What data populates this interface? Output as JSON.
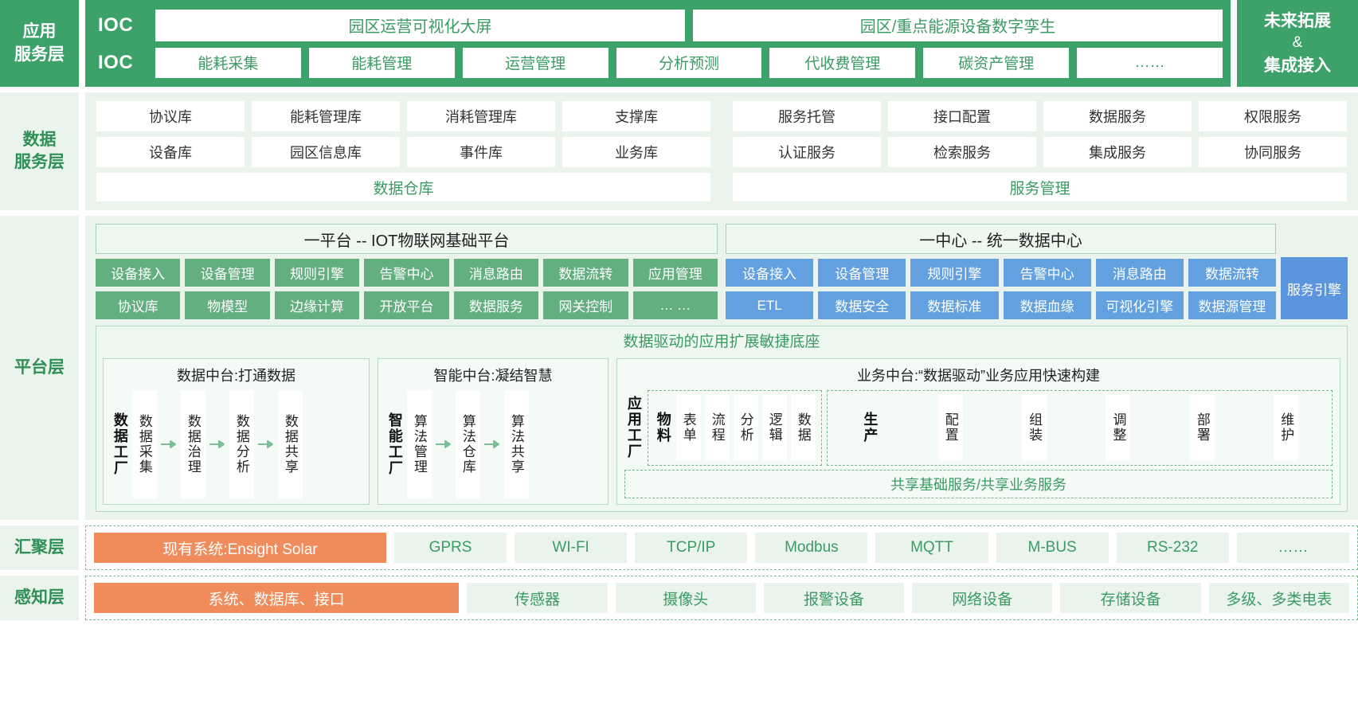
{
  "layers": {
    "application": "应用\n服务层",
    "application_l1": "应用",
    "application_l2": "服务层",
    "data_service_l1": "数据",
    "data_service_l2": "服务层",
    "platform": "平台层",
    "aggregation": "汇聚层",
    "perception": "感知层"
  },
  "application": {
    "ioc_label_top": "IOC",
    "ioc_label_bottom": "IOC",
    "top_row": [
      "园区运营可视化大屏",
      "园区/重点能源设备数字孪生"
    ],
    "bottom_row": [
      "能耗采集",
      "能耗管理",
      "运营管理",
      "分析预测",
      "代收费管理",
      "碳资产管理",
      "……"
    ],
    "side_line1": "未来拓展",
    "side_amp": "&",
    "side_line2": "集成接入"
  },
  "data_service": {
    "left": {
      "row1": [
        "协议库",
        "能耗管理库",
        "消耗管理库",
        "支撑库"
      ],
      "row2": [
        "设备库",
        "园区信息库",
        "事件库",
        "业务库"
      ],
      "footer": "数据仓库"
    },
    "right": {
      "row1": [
        "服务托管",
        "接口配置",
        "数据服务",
        "权限服务"
      ],
      "row2": [
        "认证服务",
        "检索服务",
        "集成服务",
        "协同服务"
      ],
      "footer": "服务管理"
    }
  },
  "platform": {
    "iot": {
      "title": "一平台 -- IOT物联网基础平台",
      "row1": [
        "设备接入",
        "设备管理",
        "规则引擎",
        "告警中心",
        "消息路由",
        "数据流转",
        "应用管理"
      ],
      "row2": [
        "协议库",
        "物模型",
        "边缘计算",
        "开放平台",
        "数据服务",
        "网关控制",
        "… …"
      ]
    },
    "datacenter": {
      "title": "一中心 -- 统一数据中心",
      "row1": [
        "设备接入",
        "设备管理",
        "规则引擎",
        "告警中心",
        "消息路由",
        "数据流转"
      ],
      "row2": [
        "ETL",
        "数据安全",
        "数据标准",
        "数据血缘",
        "可视化引擎",
        "数据源管理"
      ],
      "engine": "服务引擎"
    },
    "mid_title": "数据驱动的应用扩展敏捷底座",
    "data_mid": {
      "title": "数据中台:打通数据",
      "factory": "数据工厂",
      "steps": [
        "数据采集",
        "数据治理",
        "数据分析",
        "数据共享"
      ]
    },
    "ai_mid": {
      "title": "智能中台:凝结智慧",
      "factory": "智能工厂",
      "steps": [
        "算法管理",
        "算法仓库",
        "算法共享"
      ]
    },
    "biz_mid": {
      "title": "业务中台:“数据驱动”业务应用快速构建",
      "factory": "应用工厂",
      "group1_lead": "物料",
      "group1": [
        "表单",
        "流程",
        "分析",
        "逻辑",
        "数据"
      ],
      "group2_lead": "生产",
      "group2": [
        "配置",
        "组装",
        "调整",
        "部署",
        "维护"
      ],
      "footer": "共享基础服务/共享业务服务"
    }
  },
  "aggregation": {
    "items": [
      "现有系统:Ensight Solar",
      "GPRS",
      "WI-FI",
      "TCP/IP",
      "Modbus",
      "MQTT",
      "M-BUS",
      "RS-232",
      "……"
    ],
    "highlight_index": 0
  },
  "perception": {
    "items": [
      "系统、数据库、接口",
      "传感器",
      "摄像头",
      "报警设备",
      "网络设备",
      "存储设备",
      "多级、多类电表"
    ],
    "highlight_index": 0
  },
  "colors": {
    "brand_green": "#3da269",
    "tint_green": "#eaf4ed",
    "chip_green": "#63af80",
    "chip_blue": "#62a0e0",
    "engine_blue": "#5b95dd",
    "highlight_orange": "#f08b5b",
    "text_green": "#3a9b63"
  }
}
